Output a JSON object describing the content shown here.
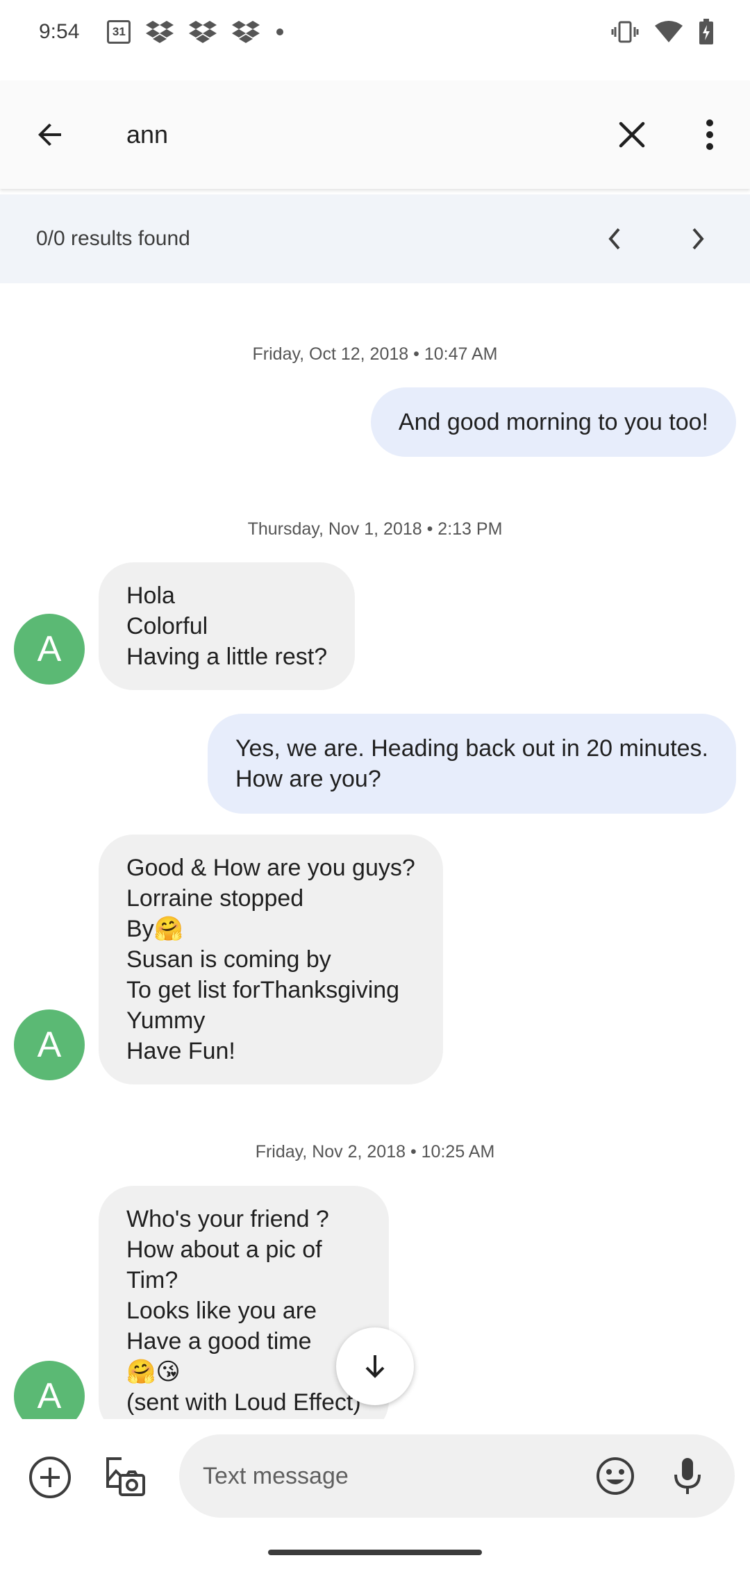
{
  "status_bar": {
    "time": "9:54",
    "calendar_day": "31",
    "icons_left": [
      "dropbox-icon",
      "dropbox-icon",
      "dropbox-icon",
      "dot-icon"
    ],
    "icons_right": [
      "vibrate-icon",
      "wifi-icon",
      "battery-icon"
    ]
  },
  "search": {
    "query": "ann",
    "results_text": "0/0 results found"
  },
  "messages": [
    {
      "type": "timestamp",
      "text": "Friday, Oct 12, 2018 • 10:47 AM"
    },
    {
      "type": "outgoing",
      "text": "And good morning to you too!"
    },
    {
      "type": "timestamp",
      "text": "Thursday, Nov 1, 2018 • 2:13 PM"
    },
    {
      "type": "incoming",
      "avatar": "A",
      "text": "Hola\nColorful\nHaving a little rest?"
    },
    {
      "type": "outgoing",
      "text": "Yes, we are. Heading back out in 20 minutes.\nHow are you?"
    },
    {
      "type": "incoming",
      "avatar": "A",
      "text": "Good & How are you guys?\nLorraine stopped\nBy🤗\nSusan is coming by\nTo get list forThanksgiving\nYummy\nHave Fun!"
    },
    {
      "type": "timestamp",
      "text": "Friday, Nov 2, 2018 • 10:25 AM"
    },
    {
      "type": "incoming",
      "avatar": "A",
      "text": "Who's your friend ?\nHow about a pic of\nTim?\nLooks like you are\nHave a good time\n🤗😘\n(sent with Loud Effect)"
    }
  ],
  "compose": {
    "placeholder": "Text message"
  },
  "colors": {
    "avatar": "#5bb974",
    "outgoing_bubble": "#e7edfb",
    "incoming_bubble": "#f0f0f0",
    "results_bar": "#f1f4f9"
  }
}
